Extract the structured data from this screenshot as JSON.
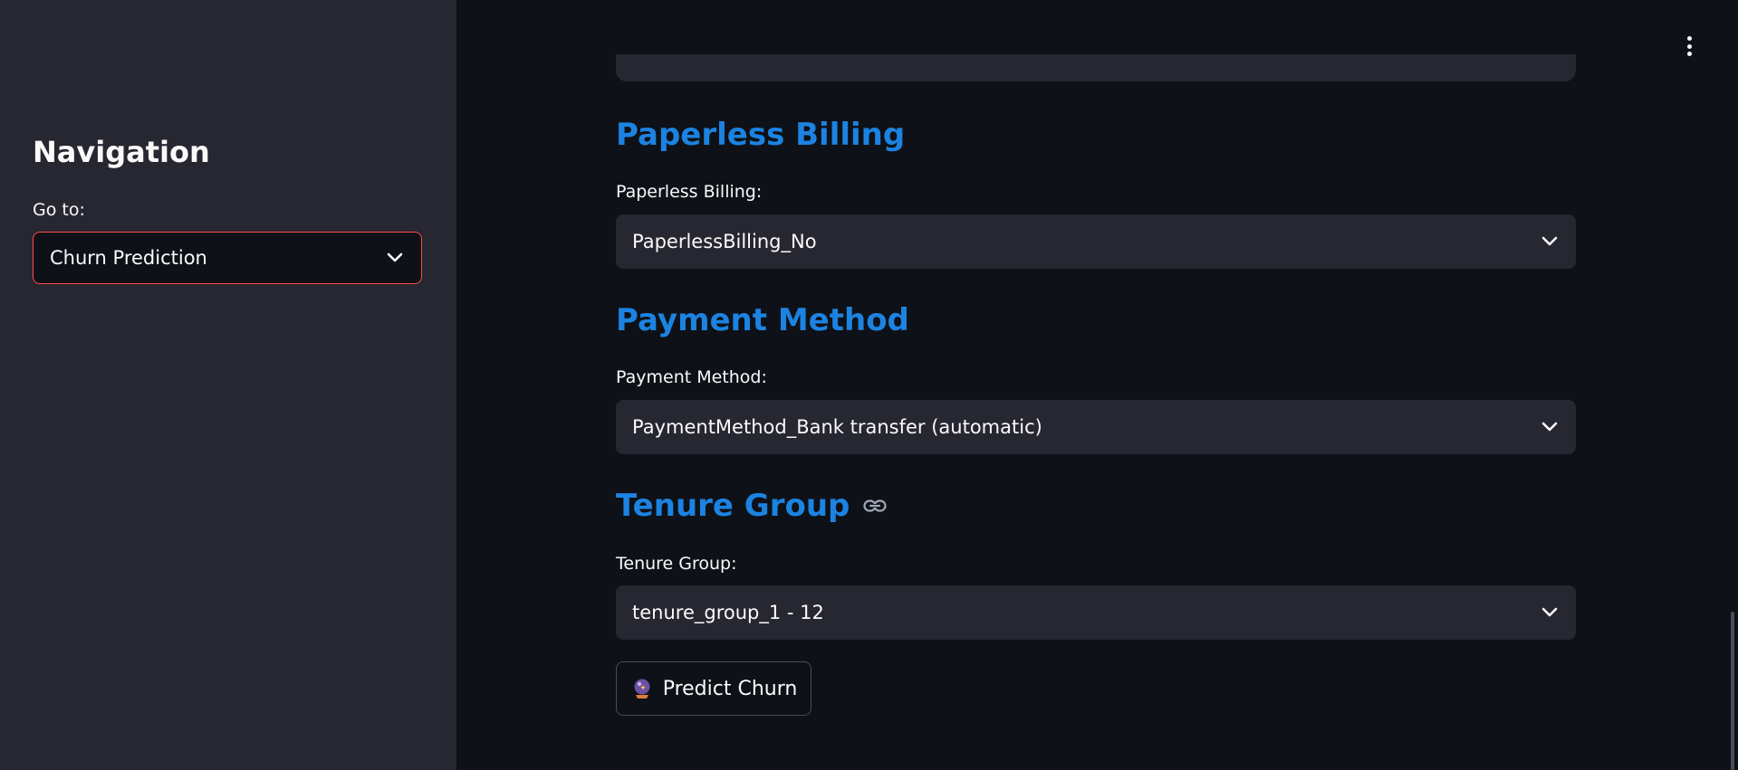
{
  "sidebar": {
    "title": "Navigation",
    "select_label": "Go to:",
    "selected_page": "Churn Prediction"
  },
  "sections": {
    "paperless": {
      "heading": "Paperless Billing",
      "label": "Paperless Billing:",
      "value": "PaperlessBilling_No"
    },
    "payment": {
      "heading": "Payment Method",
      "label": "Payment Method:",
      "value": "PaymentMethod_Bank transfer (automatic)"
    },
    "tenure": {
      "heading": "Tenure Group",
      "label": "Tenure Group:",
      "value": "tenure_group_1 - 12"
    }
  },
  "predict_button": {
    "label": "Predict Churn",
    "icon": "crystal-ball-icon"
  },
  "colors": {
    "background": "#0e1117",
    "sidebar": "#262730",
    "heading": "#1c83e1",
    "accent_border": "#ff4b4b"
  }
}
